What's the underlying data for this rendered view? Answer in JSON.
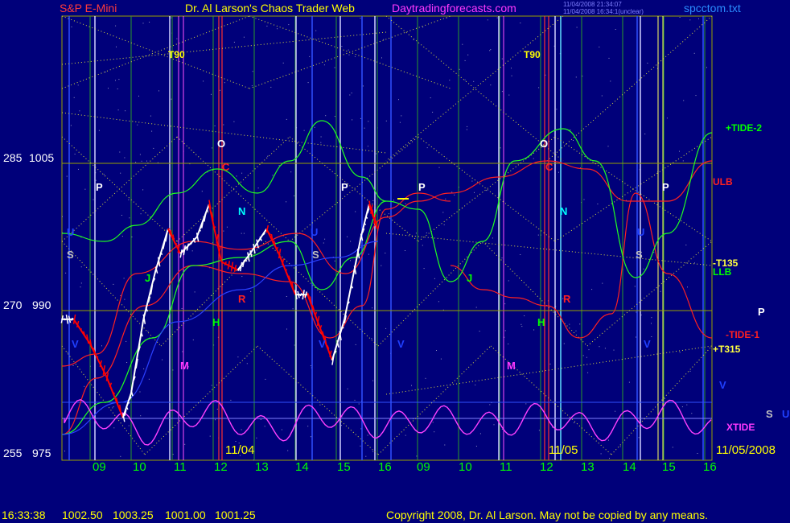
{
  "header": {
    "instrument": "S&P E-Mini",
    "title": "Dr. Al Larson's Chaos Trader Web",
    "site": "Daytradingforecasts.com",
    "stamp1": "11/04/2008 21:34:07",
    "stamp2": "11/04/2008 16:34:1(unclear)",
    "file": "spcctom.txt"
  },
  "y_axis": {
    "ticks": [
      {
        "left": "285",
        "right": "1005"
      },
      {
        "left": "270",
        "right": "990"
      },
      {
        "left": "255",
        "right": "975"
      }
    ]
  },
  "x_axis": {
    "hours_day1": [
      "09",
      "10",
      "11",
      "12",
      "13",
      "14",
      "15",
      "16"
    ],
    "hours_day2": [
      "09",
      "10",
      "11",
      "12",
      "13",
      "14",
      "15",
      "16"
    ],
    "date1": "11/04",
    "date2": "11/05",
    "date_end": "11/05/2008"
  },
  "right_labels": {
    "tide2": "+TIDE-2",
    "ulb": "ULB",
    "t135": "-T135",
    "llb": "LLB",
    "p": "P",
    "tide1": "-TIDE-1",
    "t315": "+T315",
    "v": "V",
    "s": "S",
    "u": "U",
    "xtide": "XTIDE"
  },
  "markers": {
    "t90": "T90",
    "o": "O",
    "c": "C",
    "p": "P",
    "n": "N",
    "u": "U",
    "s": "S",
    "j": "J",
    "r": "R",
    "h": "H",
    "v": "V",
    "m": "M"
  },
  "footer": {
    "time": "16:33:38",
    "open": "1002.50",
    "high": "1003.25",
    "low": "1001.00",
    "close": "1001.25",
    "copyright": "Copyright 2008, Dr. Al Larson. May not be copied by any means."
  },
  "chart_data": {
    "type": "line",
    "title": "S&P E-Mini",
    "y_range": [
      975,
      1010
    ],
    "series": [
      {
        "name": "price",
        "x_hours": [
          8.3,
          8.6,
          9.0,
          9.4,
          9.8,
          10.0,
          10.3,
          10.6,
          10.9,
          11.2,
          11.6,
          11.9,
          12.2,
          12.6,
          12.9,
          13.3,
          13.6,
          14.0,
          14.3,
          14.6,
          14.9,
          15.2,
          15.6,
          15.8,
          16.0
        ],
        "values": [
          991,
          991,
          988,
          984,
          979,
          982,
          991,
          997,
          1002,
          999,
          1001,
          1005,
          998,
          997,
          999,
          1002,
          999,
          994,
          994,
          990,
          986,
          991,
          1001,
          1005,
          1002
        ]
      }
    ],
    "colors": {
      "price_up": "#ffffff",
      "price_down": "#ff0000",
      "background": "#00007a",
      "grid": "#bcbc00"
    }
  }
}
